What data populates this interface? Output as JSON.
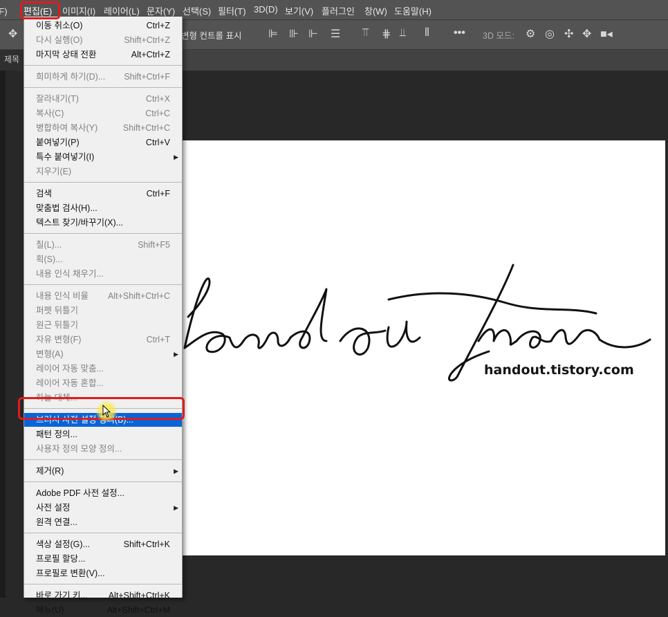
{
  "menubar": {
    "items": [
      "파일(F)",
      "편집(E)",
      "이미지(I)",
      "레이어(L)",
      "문자(Y)",
      "선택(S)",
      "필터(T)",
      "3D(D)",
      "보기(V)",
      "플러그인",
      "창(W)",
      "도움말(H)"
    ],
    "active_index": 1
  },
  "options_bar": {
    "transform_controls_label": "변형 컨트롤 표시",
    "mode_3d_label": "3D 모드:",
    "move_tool_icon": "move-icon",
    "more_icon": "ellipsis-icon"
  },
  "tab": {
    "title_fragment": "제목"
  },
  "canvas": {
    "signature_text": "handoutman",
    "url_text": "handout.tistory.com"
  },
  "edit_menu": {
    "groups": [
      [
        {
          "label": "이동 취소(O)",
          "shortcut": "Ctrl+Z",
          "disabled": false
        },
        {
          "label": "다시 실행(O)",
          "shortcut": "Shift+Ctrl+Z",
          "disabled": true
        },
        {
          "label": "마지막 상태 전환",
          "shortcut": "Alt+Ctrl+Z",
          "disabled": false
        }
      ],
      [
        {
          "label": "희미하게 하기(D)...",
          "shortcut": "Shift+Ctrl+F",
          "disabled": true
        }
      ],
      [
        {
          "label": "잘라내기(T)",
          "shortcut": "Ctrl+X",
          "disabled": true
        },
        {
          "label": "복사(C)",
          "shortcut": "Ctrl+C",
          "disabled": true
        },
        {
          "label": "병합하여 복사(Y)",
          "shortcut": "Shift+Ctrl+C",
          "disabled": true
        },
        {
          "label": "붙여넣기(P)",
          "shortcut": "Ctrl+V",
          "disabled": false
        },
        {
          "label": "특수 붙여넣기(I)",
          "shortcut": "",
          "disabled": false,
          "submenu": true
        },
        {
          "label": "지우기(E)",
          "shortcut": "",
          "disabled": true
        }
      ],
      [
        {
          "label": "검색",
          "shortcut": "Ctrl+F",
          "disabled": false
        },
        {
          "label": "맞춤법 검사(H)...",
          "shortcut": "",
          "disabled": false
        },
        {
          "label": "텍스트 찾기/바꾸기(X)...",
          "shortcut": "",
          "disabled": false
        }
      ],
      [
        {
          "label": "칠(L)...",
          "shortcut": "Shift+F5",
          "disabled": true
        },
        {
          "label": "획(S)...",
          "shortcut": "",
          "disabled": true
        },
        {
          "label": "내용 인식 채우기...",
          "shortcut": "",
          "disabled": true
        }
      ],
      [
        {
          "label": "내용 인식 비율",
          "shortcut": "Alt+Shift+Ctrl+C",
          "disabled": true
        },
        {
          "label": "퍼펫 뒤틀기",
          "shortcut": "",
          "disabled": true
        },
        {
          "label": "원근 뒤틀기",
          "shortcut": "",
          "disabled": true
        },
        {
          "label": "자유 변형(F)",
          "shortcut": "Ctrl+T",
          "disabled": true
        },
        {
          "label": "변형(A)",
          "shortcut": "",
          "disabled": true,
          "submenu": true
        },
        {
          "label": "레이어 자동 맞춤...",
          "shortcut": "",
          "disabled": true
        },
        {
          "label": "레이어 자동 혼합...",
          "shortcut": "",
          "disabled": true
        },
        {
          "label": "하늘 대체...",
          "shortcut": "",
          "disabled": true
        }
      ],
      [
        {
          "label": "브러시 사전 설정 정의(B)...",
          "shortcut": "",
          "disabled": false,
          "selected": true
        },
        {
          "label": "패턴 정의...",
          "shortcut": "",
          "disabled": false
        },
        {
          "label": "사용자 정의 모양 정의...",
          "shortcut": "",
          "disabled": true
        }
      ],
      [
        {
          "label": "제거(R)",
          "shortcut": "",
          "disabled": false,
          "submenu": true
        }
      ],
      [
        {
          "label": "Adobe PDF 사전 설정...",
          "shortcut": "",
          "disabled": false
        },
        {
          "label": "사전 설정",
          "shortcut": "",
          "disabled": false,
          "submenu": true
        },
        {
          "label": "원격 연결...",
          "shortcut": "",
          "disabled": false
        }
      ],
      [
        {
          "label": "색상 설정(G)...",
          "shortcut": "Shift+Ctrl+K",
          "disabled": false
        },
        {
          "label": "프로필 할당...",
          "shortcut": "",
          "disabled": false
        },
        {
          "label": "프로필로 변환(V)...",
          "shortcut": "",
          "disabled": false
        }
      ],
      [
        {
          "label": "바로 가기 키...",
          "shortcut": "Alt+Shift+Ctrl+K",
          "disabled": false
        },
        {
          "label": "메뉴(U)",
          "shortcut": "Alt+Shift+Ctrl+M",
          "disabled": false
        }
      ]
    ]
  },
  "colors": {
    "highlight_box": "#e01c1c",
    "menu_selection": "#0a64d7",
    "menubar_bg": "#535353",
    "workspace_bg": "#282828"
  }
}
